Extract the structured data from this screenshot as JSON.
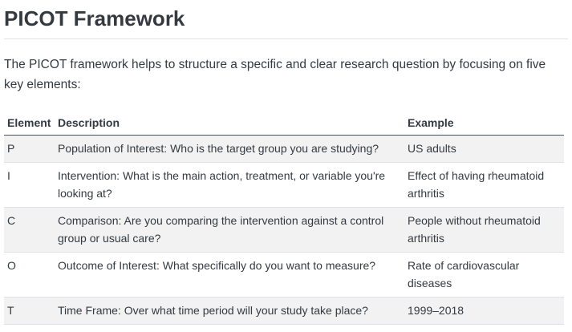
{
  "title": "PICOT Framework",
  "intro": "The PICOT framework helps to structure a specific and clear research question by focusing on five key elements:",
  "table": {
    "headers": [
      "Element",
      "Description",
      "Example"
    ],
    "rows": [
      {
        "element": "P",
        "description": "Population of Interest: Who is the target group you are studying?",
        "example": "US adults"
      },
      {
        "element": "I",
        "description": "Intervention: What is the main action, treatment, or variable you're looking at?",
        "example": "Effect of having rheumatoid arthritis"
      },
      {
        "element": "C",
        "description": "Comparison: Are you comparing the intervention against a control group or usual care?",
        "example": "People without rheumatoid arthritis"
      },
      {
        "element": "O",
        "description": "Outcome of Interest: What specifically do you want to measure?",
        "example": "Rate of cardiovascular diseases"
      },
      {
        "element": "T",
        "description": "Time Frame: Over what time period will your study take place?",
        "example": "1999–2018"
      }
    ]
  }
}
